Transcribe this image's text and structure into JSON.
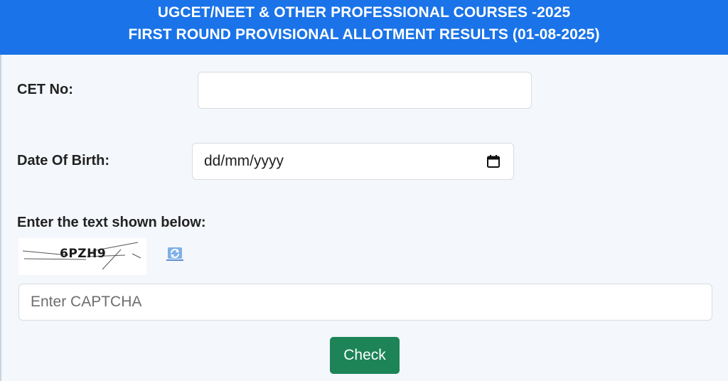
{
  "header": {
    "line1": "UGCET/NEET & OTHER PROFESSIONAL COURSES -2025",
    "line2": "FIRST ROUND PROVISIONAL ALLOTMENT RESULTS (01-08-2025)"
  },
  "form": {
    "cet_no_label": "CET No:",
    "cet_no_value": "",
    "dob_label": "Date Of Birth:",
    "dob_placeholder": "dd/mm/yyyy",
    "captcha_label": "Enter the text shown below:",
    "captcha_text": "6PZH9",
    "captcha_placeholder": "Enter CAPTCHA",
    "check_label": "Check"
  },
  "colors": {
    "header_bg": "#1a73e8",
    "button_bg": "#1c8456",
    "page_bg": "#f4f7fb"
  },
  "icons": {
    "calendar": "calendar-icon",
    "refresh": "refresh-icon"
  }
}
